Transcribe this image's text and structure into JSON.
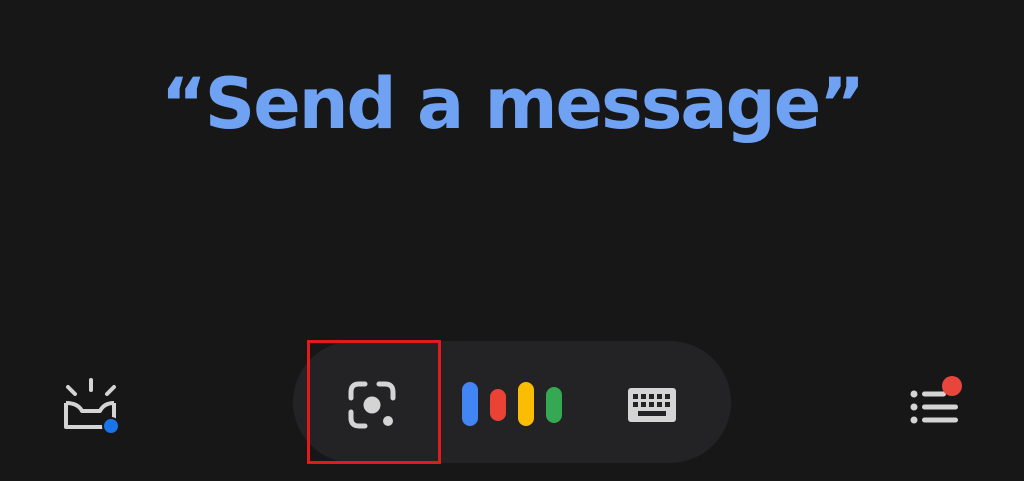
{
  "assistant": {
    "prompt_text": "“Send a message”",
    "colors": {
      "background": "#171718",
      "pill_background": "#232325",
      "prompt_text": "#6fa2f3",
      "icon_gray": "#d4d4d4",
      "google_blue": "#4285f4",
      "google_red": "#ea4335",
      "google_yellow": "#fbbc04",
      "google_green": "#34a853",
      "notification_blue": "#1a73e8",
      "notification_red": "#e8453c",
      "highlight": "#e01b1b"
    }
  },
  "bottom_bar": {
    "left_icon": "snapshot-inbox-icon",
    "center_icons": [
      "lens-icon",
      "microphone-bars-icon",
      "keyboard-icon"
    ],
    "right_icon": "explore-list-icon"
  }
}
